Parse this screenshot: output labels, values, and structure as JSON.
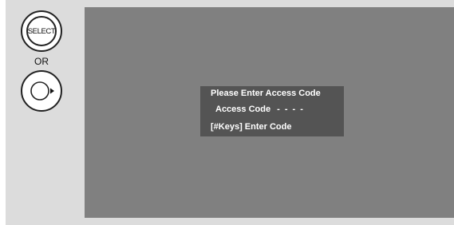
{
  "remote": {
    "select_label": "SELECT",
    "or_label": "OR",
    "nav_icon": "enter-right-icon"
  },
  "dialog": {
    "title": "Please Enter Access Code",
    "code_label": "Access Code",
    "code_value": "- - - -",
    "hint": "[#Keys] Enter Code"
  },
  "colors": {
    "screen": "#808080",
    "dialog": "#545454",
    "panel": "#dcdcdc"
  }
}
